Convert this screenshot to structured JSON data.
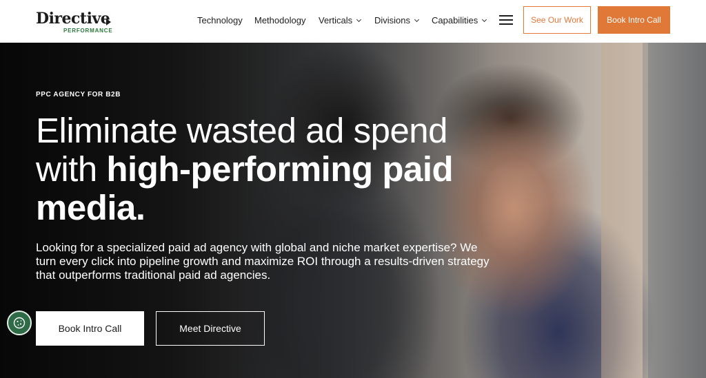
{
  "header": {
    "logo": {
      "main": "Directive",
      "sub": "PERFORMANCE"
    },
    "nav": [
      {
        "label": "Technology",
        "dropdown": false
      },
      {
        "label": "Methodology",
        "dropdown": false
      },
      {
        "label": "Verticals",
        "dropdown": true
      },
      {
        "label": "Divisions",
        "dropdown": true
      },
      {
        "label": "Capabilities",
        "dropdown": true
      }
    ],
    "see_work_label": "See Our Work",
    "book_call_label": "Book Intro Call"
  },
  "hero": {
    "eyebrow": "PPC AGENCY FOR B2B",
    "headline_light": "Eliminate wasted ad spend with ",
    "headline_bold": "high-performing paid media.",
    "subtext": "Looking for a specialized paid ad agency with global and niche market expertise? We turn every click into pipeline growth and maximize ROI through a results-driven strategy that outperforms traditional paid ad agencies.",
    "primary_cta": "Book Intro Call",
    "secondary_cta": "Meet Directive"
  },
  "icons": {
    "menu": "hamburger-menu-icon",
    "cookie": "cookie-icon"
  },
  "colors": {
    "accent_orange": "#e07838",
    "logo_green": "#2a7a3a",
    "cookie_green": "#2f6b46"
  }
}
